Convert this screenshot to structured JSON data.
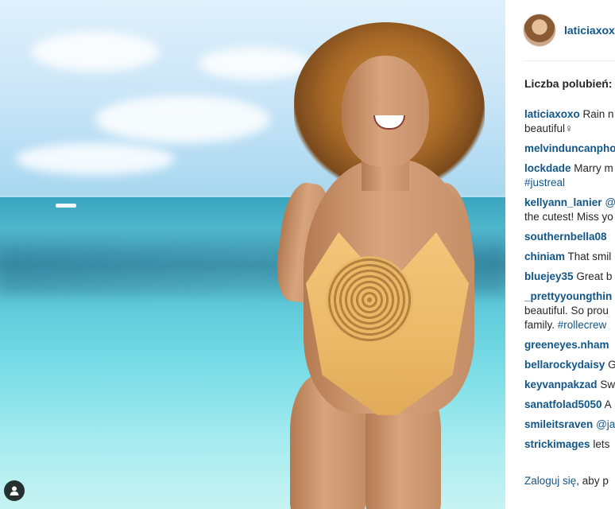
{
  "post": {
    "owner": "laticiaxoxo",
    "likes_label": "Liczba polubień:",
    "comments": [
      {
        "user": "laticiaxoxo",
        "text": "Rain n",
        "cont": "beautiful♀"
      },
      {
        "user": "melvinduncanpho",
        "text": "",
        "cont": ""
      },
      {
        "user": "lockdade",
        "text": "Marry m",
        "cont": "#justreal"
      },
      {
        "user": "kellyann_lanier",
        "text": "@",
        "cont": "the cutest! Miss yo"
      },
      {
        "user": "southernbella08",
        "text": "",
        "cont": ""
      },
      {
        "user": "chiniam",
        "text": "That smil",
        "cont": ""
      },
      {
        "user": "bluejey35",
        "text": "Great b",
        "cont": ""
      },
      {
        "user": "_prettyyoungthin",
        "text": "",
        "cont": "beautiful. So prou",
        "cont2": "family. ",
        "tag2": "#rollecrew"
      },
      {
        "user": "greeneyes.nham",
        "text": "",
        "cont": ""
      },
      {
        "user": "bellarockydaisy",
        "text": "G",
        "cont": ""
      },
      {
        "user": "keyvanpakzad",
        "text": "Sw",
        "cont": ""
      },
      {
        "user": "sanatfolad5050",
        "text": "A",
        "cont": ""
      },
      {
        "user": "smileitsraven",
        "text": "@ja",
        "cont": ""
      },
      {
        "user": "strickimages",
        "text": "lets",
        "cont": ""
      }
    ],
    "footer": {
      "login": "Zaloguj się",
      "rest": ", aby p"
    }
  },
  "icons": {
    "photo_tag": "user-tag-icon"
  }
}
